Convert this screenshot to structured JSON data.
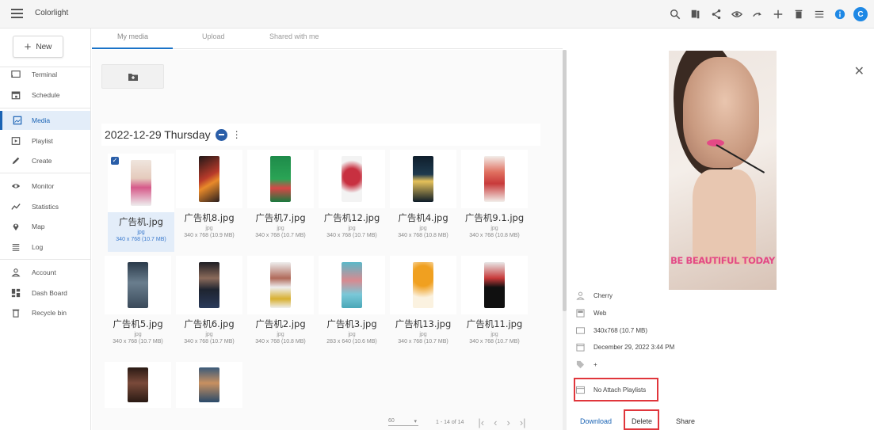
{
  "app": {
    "title": "Colorlight"
  },
  "topbar": {
    "icons": [
      "search-icon",
      "bookmark-icon",
      "share-icon",
      "eye-icon",
      "redo-icon",
      "plus-icon",
      "trash-icon",
      "menu-icon",
      "info-icon"
    ],
    "avatar_letter": "C",
    "accent": "#1e88e5"
  },
  "sidebar": {
    "new_label": "New",
    "items": [
      {
        "label": "Terminal",
        "icon": "cast-icon"
      },
      {
        "label": "Schedule",
        "icon": "calendar-icon"
      },
      {
        "label": "Media",
        "icon": "image-icon",
        "active": true
      },
      {
        "label": "Playlist",
        "icon": "playlist-icon"
      },
      {
        "label": "Create",
        "icon": "pencil-icon"
      },
      {
        "label": "Monitor",
        "icon": "eye-icon"
      },
      {
        "label": "Statistics",
        "icon": "trend-icon"
      },
      {
        "label": "Map",
        "icon": "location-icon"
      },
      {
        "label": "Log",
        "icon": "list-icon"
      },
      {
        "label": "Account",
        "icon": "person-icon"
      },
      {
        "label": "Dash Board",
        "icon": "dashboard-icon"
      },
      {
        "label": "Recycle bin",
        "icon": "trash-icon"
      }
    ]
  },
  "tabs": [
    {
      "label": "My media",
      "active": true
    },
    {
      "label": "Upload"
    },
    {
      "label": "Shared with me"
    }
  ],
  "media": {
    "date_header": "2022-12-29 Thursday",
    "files": [
      {
        "name": "广告机.jpg",
        "type": "jpg",
        "size": "340 x 768 (10.7 MB)",
        "selected": true
      },
      {
        "name": "广告机8.jpg",
        "type": "jpg",
        "size": "340 x 768 (10.9 MB)"
      },
      {
        "name": "广告机7.jpg",
        "type": "jpg",
        "size": "340 x 768 (10.7 MB)"
      },
      {
        "name": "广告机12.jpg",
        "type": "jpg",
        "size": "340 x 768 (10.7 MB)"
      },
      {
        "name": "广告机4.jpg",
        "type": "jpg",
        "size": "340 x 768 (10.8 MB)"
      },
      {
        "name": "广告机9.1.jpg",
        "type": "jpg",
        "size": "340 x 768 (10.8 MB)"
      },
      {
        "name": "广告机5.jpg",
        "type": "jpg",
        "size": "340 x 768 (10.7 MB)"
      },
      {
        "name": "广告机6.jpg",
        "type": "jpg",
        "size": "340 x 768 (10.7 MB)"
      },
      {
        "name": "广告机2.jpg",
        "type": "jpg",
        "size": "340 x 768 (10.8 MB)"
      },
      {
        "name": "广告机3.jpg",
        "type": "jpg",
        "size": "283 x 640 (10.6 MB)"
      },
      {
        "name": "广告机13.jpg",
        "type": "jpg",
        "size": "340 x 768 (10.7 MB)"
      },
      {
        "name": "广告机11.jpg",
        "type": "jpg",
        "size": "340 x 768 (10.7 MB)"
      },
      {
        "name": "",
        "type": "",
        "size": ""
      },
      {
        "name": "",
        "type": "",
        "size": ""
      }
    ]
  },
  "pager": {
    "per_page": "60",
    "range": "1 - 14 of 14"
  },
  "detail": {
    "preview_caption": "BE BEAUTIFUL TODAY",
    "owner": "Cherry",
    "source": "Web",
    "dimensions": "340x768 (10.7 MB)",
    "date": "December 29, 2022 3:44 PM",
    "tag_add": "+",
    "playlists": "No Attach Playlists",
    "download_label": "Download",
    "delete_label": "Delete",
    "share_label": "Share",
    "link_color": "#1a63b4",
    "highlight_color": "#e0363c"
  }
}
